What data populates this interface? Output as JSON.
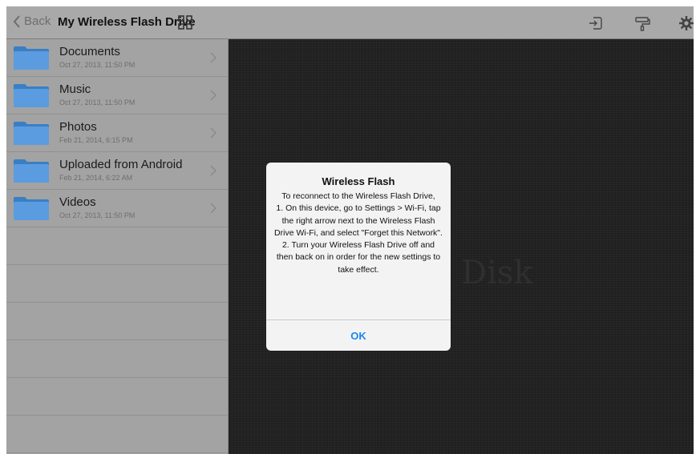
{
  "header": {
    "back_label": "Back",
    "title": "My Wireless Flash Drive",
    "icons": [
      "grid-view-icon",
      "import-icon",
      "paint-roller-icon",
      "gear-icon"
    ]
  },
  "sidebar": {
    "items": [
      {
        "name": "Documents",
        "date": "Oct 27, 2013, 11:50 PM",
        "icon": "folder-icon"
      },
      {
        "name": "Music",
        "date": "Oct 27, 2013, 11:50 PM",
        "icon": "folder-icon"
      },
      {
        "name": "Photos",
        "date": "Feb 21, 2014, 6:15 PM",
        "icon": "folder-icon"
      },
      {
        "name": "Uploaded from Android",
        "date": "Feb 21, 2014, 6:22 AM",
        "icon": "folder-icon"
      },
      {
        "name": "Videos",
        "date": "Oct 27, 2013, 11:50 PM",
        "icon": "folder-icon"
      }
    ]
  },
  "main": {
    "watermark": "Disk"
  },
  "dialog": {
    "title": "Wireless Flash",
    "message": "To reconnect to the Wireless Flash Drive,\n1. On this device, go to Settings > Wi-Fi, tap the right arrow next to the Wireless Flash Drive Wi-Fi, and select \"Forget this Network\".\n2. Turn your Wireless Flash Drive off and then back on in order for the new settings to take effect.",
    "ok_label": "OK"
  },
  "colors": {
    "accent": "#1b86f0",
    "folder": "#4a90d9"
  }
}
